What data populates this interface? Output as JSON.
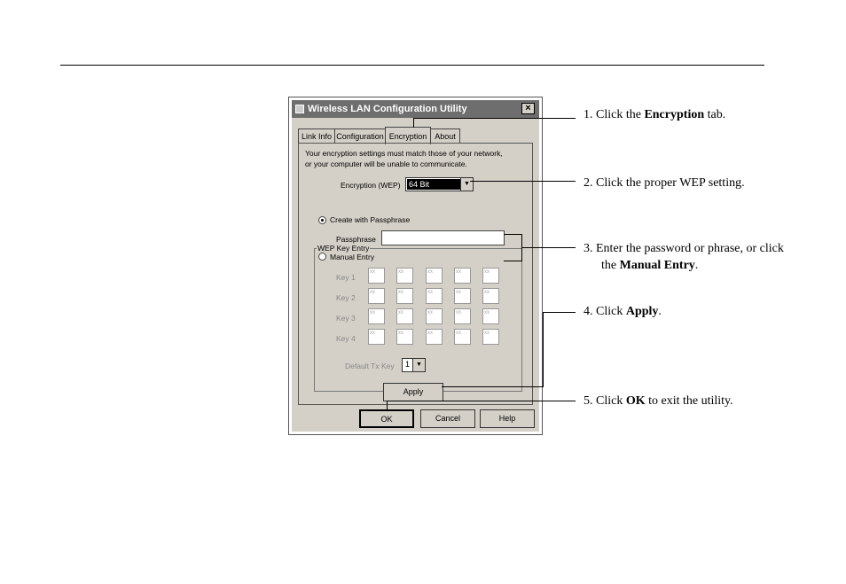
{
  "dialog": {
    "title": "Wireless LAN Configuration Utility",
    "close_glyph": "×",
    "tabs": [
      {
        "label": "Link Info"
      },
      {
        "label": "Configuration"
      },
      {
        "label": "Encryption",
        "active": true
      },
      {
        "label": "About"
      }
    ],
    "notice_line1": "Your encryption settings must match those of your network,",
    "notice_line2": "or your computer will be unable to communicate.",
    "encryption_label": "Encryption (WEP)",
    "encryption_value": "64 Bit",
    "wep_group_label": "WEP Key Entry",
    "radio_passphrase_label": "Create with Passphrase",
    "passphrase_label": "Passphrase",
    "passphrase_value": "",
    "radio_manual_label": "Manual Entry",
    "keys": [
      {
        "label": "Key 1",
        "cells": [
          "xx",
          "xx",
          "xx",
          "xx",
          "xx"
        ]
      },
      {
        "label": "Key 2",
        "cells": [
          "xx",
          "xx",
          "xx",
          "xx",
          "xx"
        ]
      },
      {
        "label": "Key 3",
        "cells": [
          "xx",
          "xx",
          "xx",
          "xx",
          "xx"
        ]
      },
      {
        "label": "Key 4",
        "cells": [
          "xx",
          "xx",
          "xx",
          "xx",
          "xx"
        ]
      }
    ],
    "default_tx_label": "Default Tx Key",
    "default_tx_value": "1",
    "apply_label": "Apply",
    "ok_label": "OK",
    "cancel_label": "Cancel",
    "help_label": "Help",
    "dropdown_glyph": "▼"
  },
  "annotations": {
    "step1_pre": "1. Click the ",
    "step1_bold": "Encryption",
    "step1_post": " tab.",
    "step2": "2. Click the proper WEP setting.",
    "step3_line1": "3. Enter the password or phrase, or click",
    "step3_pre": "the ",
    "step3_bold": "Manual Entry",
    "step3_post": ".",
    "step4_pre": "4. Click ",
    "step4_bold": "Apply",
    "step4_post": ".",
    "step5_pre": "5. Click ",
    "step5_bold": "OK",
    "step5_post": " to exit the utility."
  },
  "colors": {
    "titlebar": "#6e6e6e",
    "dialog_face": "#d4d0c8"
  }
}
